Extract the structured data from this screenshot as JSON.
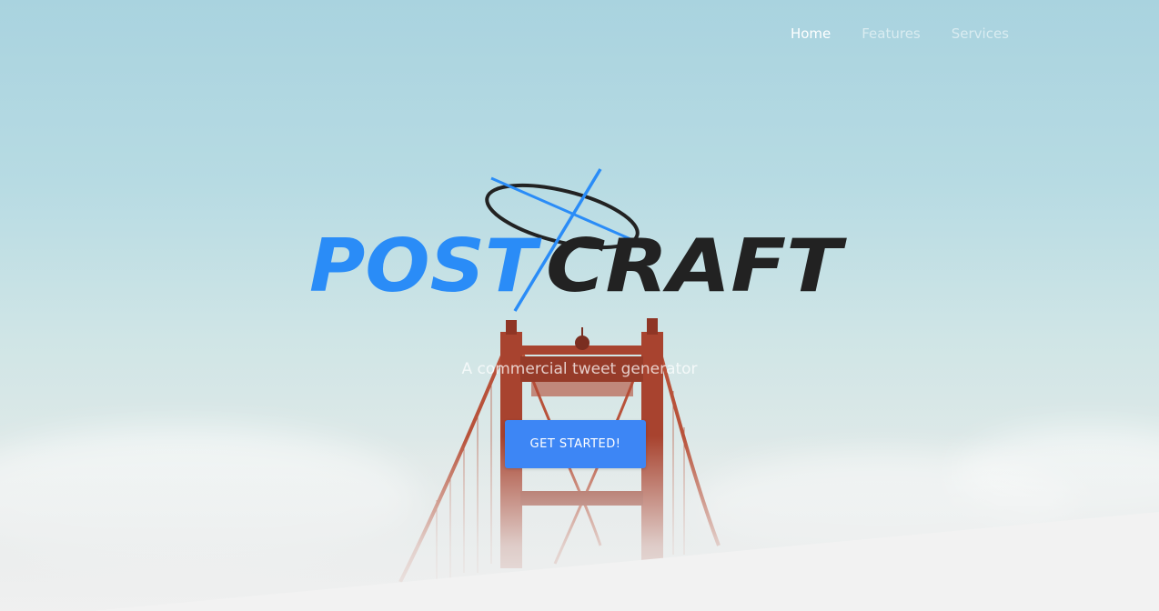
{
  "nav": {
    "items": [
      {
        "label": "Home",
        "active": true
      },
      {
        "label": "Features",
        "active": false
      },
      {
        "label": "Services",
        "active": false
      }
    ]
  },
  "brand": {
    "part1": "POST",
    "part2": "CRAFT",
    "part1_color": "#2a8cf7",
    "part2_color": "#222222"
  },
  "hero": {
    "subtitle": "A commercial tweet generator",
    "cta_label": "GET STARTED!",
    "cta_color": "#3d86f5"
  }
}
